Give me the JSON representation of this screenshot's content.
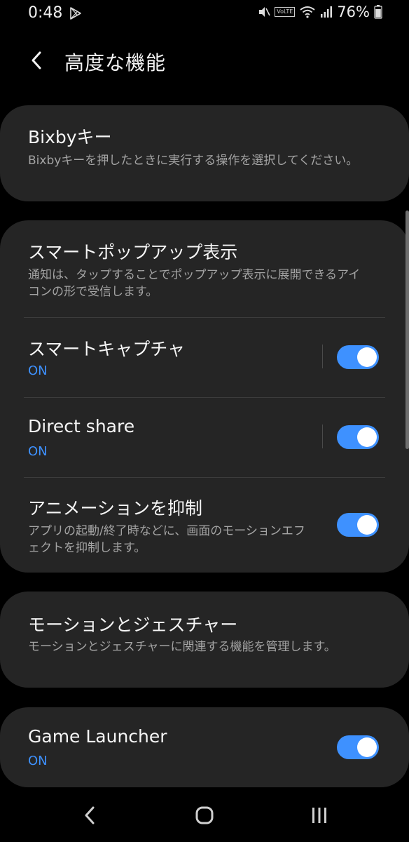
{
  "status_bar": {
    "time": "0:48",
    "volte": "VoLTE",
    "battery_percent": "76%"
  },
  "header": {
    "title": "高度な機能"
  },
  "sections": [
    {
      "items": [
        {
          "title": "Bixbyキー",
          "subtitle": "Bixbyキーを押したときに実行する操作を選択してください。"
        }
      ]
    },
    {
      "items": [
        {
          "title": "スマートポップアップ表示",
          "subtitle": "通知は、タップすることでポップアップ表示に展開できるアイコンの形で受信します。"
        },
        {
          "title": "スマートキャプチャ",
          "status": "ON",
          "toggle": true
        },
        {
          "title": "Direct share",
          "status": "ON",
          "toggle": true
        },
        {
          "title": "アニメーションを抑制",
          "subtitle": "アプリの起動/終了時などに、画面のモーションエフェクトを抑制します。",
          "toggle": true
        }
      ]
    },
    {
      "items": [
        {
          "title": "モーションとジェスチャー",
          "subtitle": "モーションとジェスチャーに関連する機能を管理します。"
        }
      ]
    },
    {
      "items": [
        {
          "title": "Game Launcher",
          "status": "ON",
          "toggle": true
        }
      ]
    }
  ],
  "nav_bar": {
    "icons": [
      "back-icon",
      "home-icon",
      "recents-icon"
    ]
  },
  "colors": {
    "background": "#000000",
    "card": "#252525",
    "accent": "#3e91ff",
    "subtext": "#a4a4a4"
  }
}
